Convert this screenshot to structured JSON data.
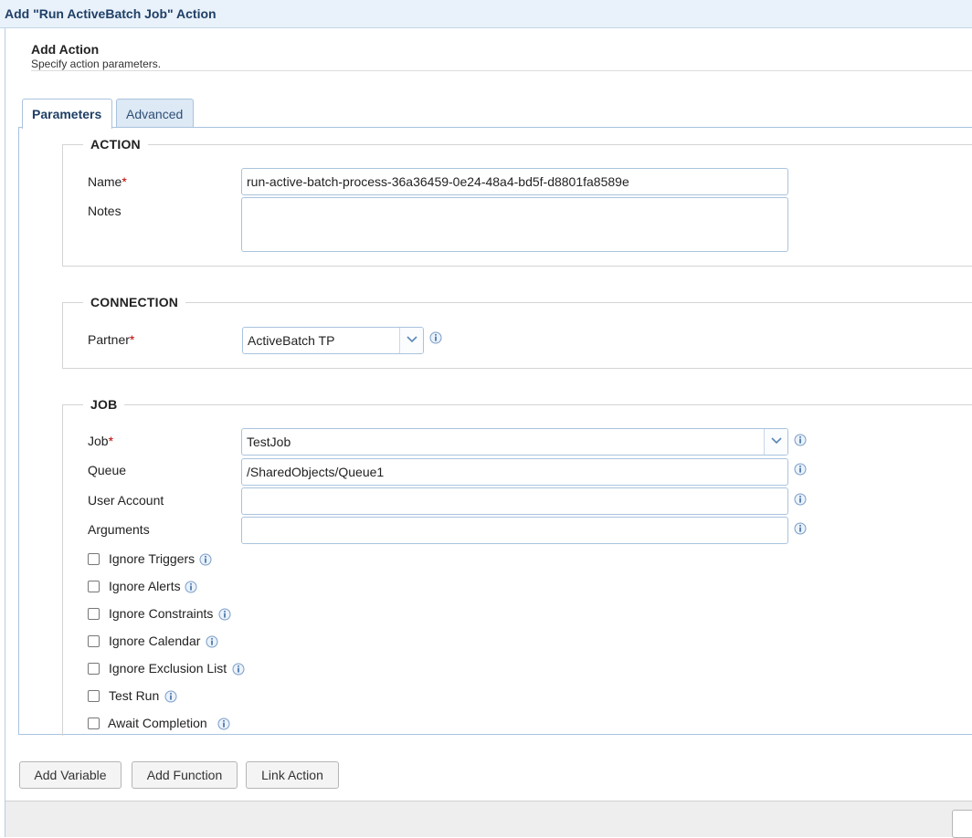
{
  "window": {
    "title": "Add \"Run ActiveBatch Job\" Action"
  },
  "header": {
    "title": "Add Action",
    "subtitle": "Specify action parameters."
  },
  "tabs": [
    {
      "label": "Parameters",
      "active": true
    },
    {
      "label": "Advanced",
      "active": false
    }
  ],
  "sections": {
    "action": {
      "legend": "ACTION",
      "name_label": "Name",
      "name_value": "run-active-batch-process-36a36459-0e24-48a4-bd5f-d8801fa8589e",
      "notes_label": "Notes",
      "notes_value": ""
    },
    "connection": {
      "legend": "CONNECTION",
      "partner_label": "Partner",
      "partner_value": "ActiveBatch TP"
    },
    "job": {
      "legend": "JOB",
      "job_label": "Job",
      "job_value": "TestJob",
      "queue_label": "Queue",
      "queue_value": "/SharedObjects/Queue1",
      "user_account_label": "User Account",
      "user_account_value": "",
      "arguments_label": "Arguments",
      "arguments_value": "",
      "checkboxes": [
        {
          "label": "Ignore Triggers",
          "checked": false
        },
        {
          "label": "Ignore Alerts",
          "checked": false
        },
        {
          "label": "Ignore Constraints",
          "checked": false
        },
        {
          "label": "Ignore Calendar",
          "checked": false
        },
        {
          "label": "Ignore Exclusion List",
          "checked": false
        },
        {
          "label": "Test Run",
          "checked": false
        },
        {
          "label": "Await Completion",
          "checked": false
        }
      ]
    }
  },
  "required_marker": "*",
  "buttons": {
    "add_variable": "Add Variable",
    "add_function": "Add Function",
    "link_action": "Link Action"
  },
  "icons": {
    "info": "info-icon",
    "dropdown": "chevron-down-icon"
  },
  "colors": {
    "title_text": "#1f3f66",
    "border_accent": "#a9c3de",
    "required": "#c00000"
  }
}
